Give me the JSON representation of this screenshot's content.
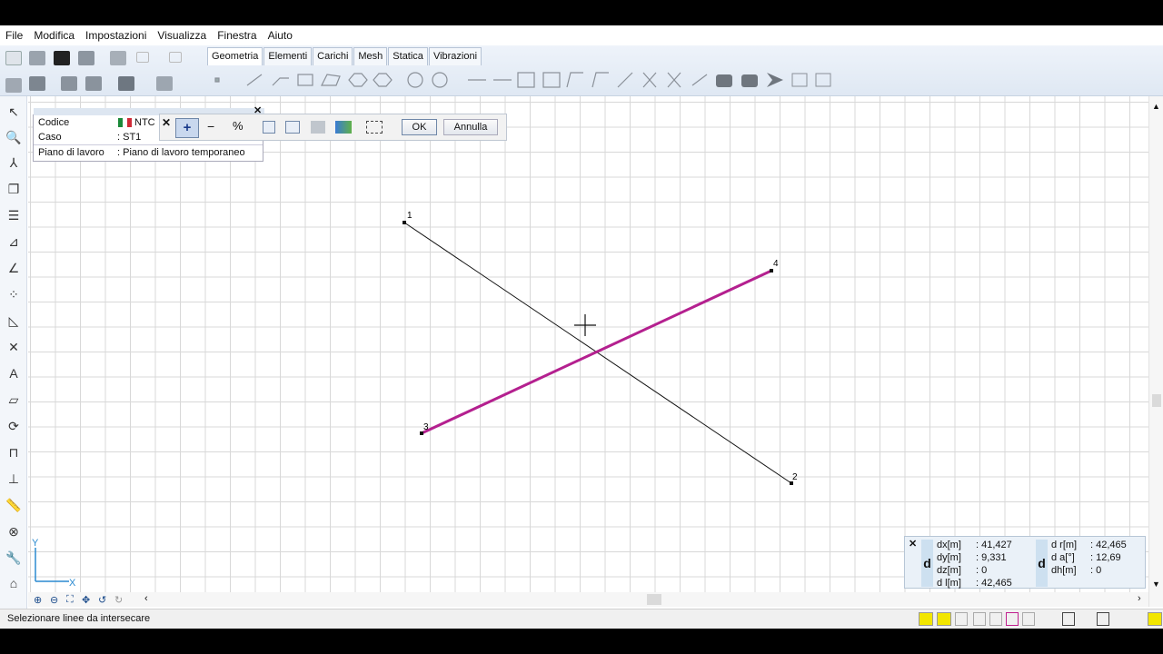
{
  "menubar": {
    "items": [
      "File",
      "Modifica",
      "Impostazioni",
      "Visualizza",
      "Finestra",
      "Aiuto"
    ]
  },
  "tabs": [
    "Geometria",
    "Elementi",
    "Carichi",
    "Mesh",
    "Statica",
    "Vibrazioni"
  ],
  "info_panel": {
    "codice_label": "Codice",
    "codice_value": "NTC",
    "caso_label": "Caso",
    "caso_value": ": ST1",
    "piano_label": "Piano di lavoro",
    "piano_value": ": Piano di lavoro temporaneo"
  },
  "command_bar": {
    "plus": "+",
    "minus": "−",
    "percent": "%",
    "ok": "OK",
    "cancel": "Annulla"
  },
  "nodes": [
    {
      "id": "1",
      "label": "1"
    },
    {
      "id": "2",
      "label": "2"
    },
    {
      "id": "3",
      "label": "3"
    },
    {
      "id": "4",
      "label": "4"
    }
  ],
  "axes": {
    "x": "X",
    "y": "Y"
  },
  "coordinates": {
    "dx_label": "dx[m]",
    "dx_value": ": 41,427",
    "dy_label": "dy[m]",
    "dy_value": ": 9,331",
    "dz_label": "dz[m]",
    "dz_value": ": 0",
    "dl_label": "d l[m]",
    "dl_value": ": 42,465",
    "dr_label": "d r[m]",
    "dr_value": ": 42,465",
    "da_label": "d  a[°]",
    "da_value": ": 12,69",
    "dh_label": "dh[m]",
    "dh_value": ": 0",
    "d_badge": "d"
  },
  "status": {
    "message": "Selezionare linee da intersecare"
  },
  "colors": {
    "accent_line": "#b4208f",
    "line": "#111111",
    "toolbar_bg": "#e6edf6"
  },
  "icons": [
    "new-file-icon",
    "open-icon",
    "save-icon",
    "print-icon",
    "undo-icon",
    "redo-icon",
    "zoom-icon",
    "pointer-icon"
  ]
}
